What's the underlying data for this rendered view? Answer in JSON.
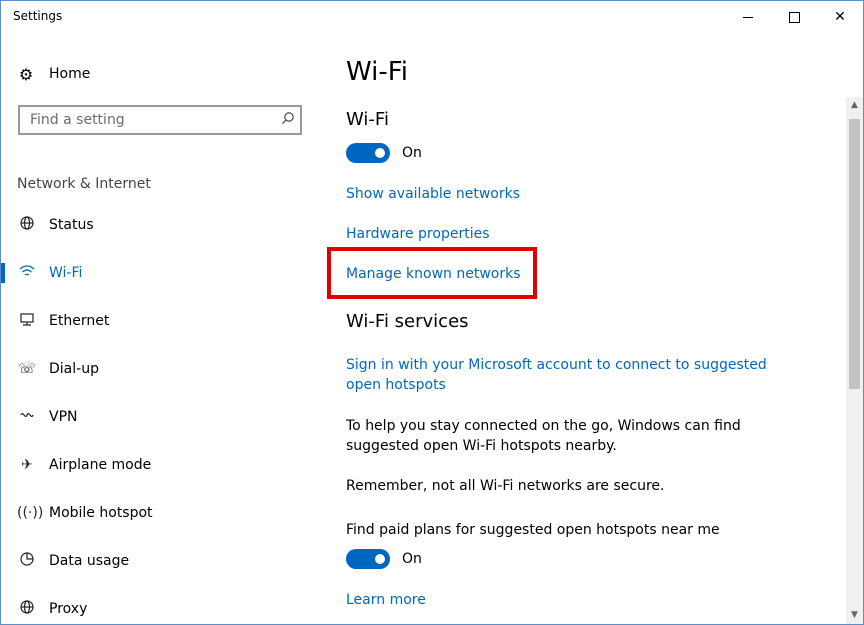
{
  "window": {
    "title": "Settings"
  },
  "sidebar": {
    "home_label": "Home",
    "search_placeholder": "Find a setting",
    "section_title": "Network & Internet",
    "items": [
      {
        "label": "Status",
        "icon": "status-icon"
      },
      {
        "label": "Wi-Fi",
        "icon": "wifi-icon",
        "active": true
      },
      {
        "label": "Ethernet",
        "icon": "ethernet-icon"
      },
      {
        "label": "Dial-up",
        "icon": "dialup-icon"
      },
      {
        "label": "VPN",
        "icon": "vpn-icon"
      },
      {
        "label": "Airplane mode",
        "icon": "airplane-icon"
      },
      {
        "label": "Mobile hotspot",
        "icon": "hotspot-icon"
      },
      {
        "label": "Data usage",
        "icon": "data-usage-icon"
      },
      {
        "label": "Proxy",
        "icon": "globe-icon"
      }
    ]
  },
  "main": {
    "page_title": "Wi-Fi",
    "wifi_heading": "Wi-Fi",
    "wifi_toggle_state": "On",
    "links": {
      "show_available": "Show available networks",
      "hardware_properties": "Hardware properties",
      "manage_known": "Manage known networks"
    },
    "services_heading": "Wi-Fi services",
    "sign_in_link": "Sign in with your Microsoft account to connect to suggested open hotspots",
    "para_help": "To help you stay connected on the go, Windows can find suggested open Wi-Fi hotspots nearby.",
    "para_remember": "Remember, not all Wi-Fi networks are secure.",
    "paid_plans_label": "Find paid plans for suggested open hotspots near me",
    "paid_toggle_state": "On",
    "learn_more": "Learn more"
  },
  "colors": {
    "accent": "#0067c0",
    "highlight": "#e00000"
  }
}
